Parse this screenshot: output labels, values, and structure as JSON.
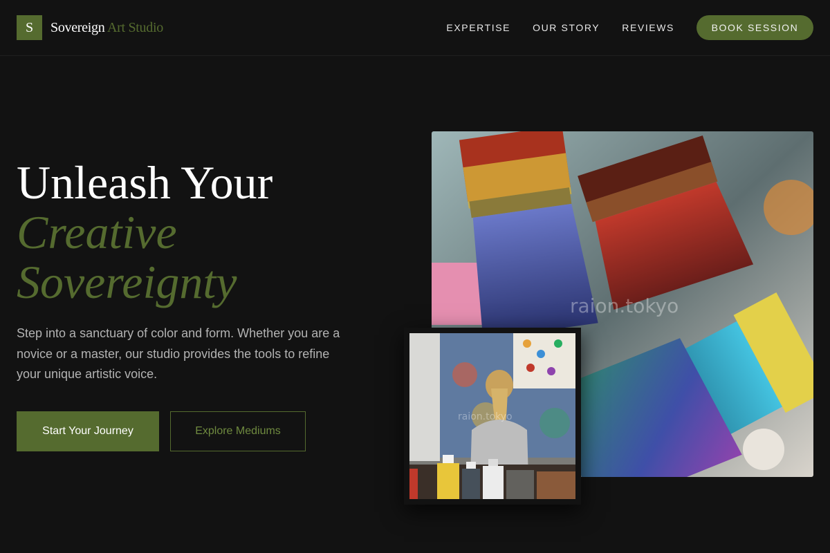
{
  "brand": {
    "mark": "S",
    "name_primary": "Sovereign",
    "name_accent": "Art Studio"
  },
  "nav": {
    "links": [
      "EXPERTISE",
      "OUR STORY",
      "REVIEWS"
    ],
    "cta": "BOOK SESSION"
  },
  "hero": {
    "title_line1": "Unleash Your",
    "title_line2": "Creative",
    "title_line3": "Sovereignty",
    "description": "Step into a sanctuary of color and form. Whether you are a novice or a master, our studio provides the tools to refine your unique artistic voice.",
    "primary_button": "Start Your Journey",
    "secondary_button": "Explore Mediums"
  },
  "images": {
    "main_watermark": "raion.tokyo",
    "small_watermark": "raion.tokyo"
  },
  "colors": {
    "background": "#121212",
    "accent": "#556b2f",
    "text_muted": "#b3b3b3"
  },
  "icons": {
    "main_image": "paintbrushes-photo",
    "small_image": "child-painting-photo"
  }
}
